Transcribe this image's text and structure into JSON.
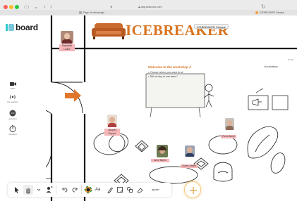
{
  "browser": {
    "url": "app.klaxoon.com",
    "tab_left": "Page de démarrage",
    "tab_right": "ICEBREAKER Canapé"
  },
  "app": {
    "logo": "board"
  },
  "sidebar": {
    "items": [
      {
        "label": "vidéo",
        "icon": "video-icon"
      },
      {
        "label": "live session",
        "icon": "broadcast-icon"
      },
      {
        "label": "question",
        "icon": "chat-icon"
      },
      {
        "label": "minuteur",
        "icon": "timer-icon"
      }
    ]
  },
  "board": {
    "title": "ICEBREAKER",
    "title_tooltip": "ICEBREAKER Canapé",
    "corner_label": "10:00",
    "welcome": {
      "heading": "Welcome to the workshop 2",
      "lines": [
        "Choose where you want to sit",
        "Tell us why in one word !"
      ]
    },
    "annotation": "You at/ableau",
    "participants": [
      {
        "name": "Raphaëlle Laubie"
      },
      {
        "name": "Jacques Dupont"
      },
      {
        "name": "Anne Martin"
      },
      {
        "name": "Claire Lefèvre"
      },
      {
        "name": "Pierre Morel"
      }
    ]
  },
  "toolbar": {
    "aa_label": "Aa",
    "ajouter_label": "ajouter"
  },
  "colors": {
    "accent": "#f2a03d",
    "title_orange": "#d9731f",
    "badge_pink": "#f7b6b8",
    "sofa_orange": "#c96a2e",
    "arrow_orange": "#e2772b"
  }
}
